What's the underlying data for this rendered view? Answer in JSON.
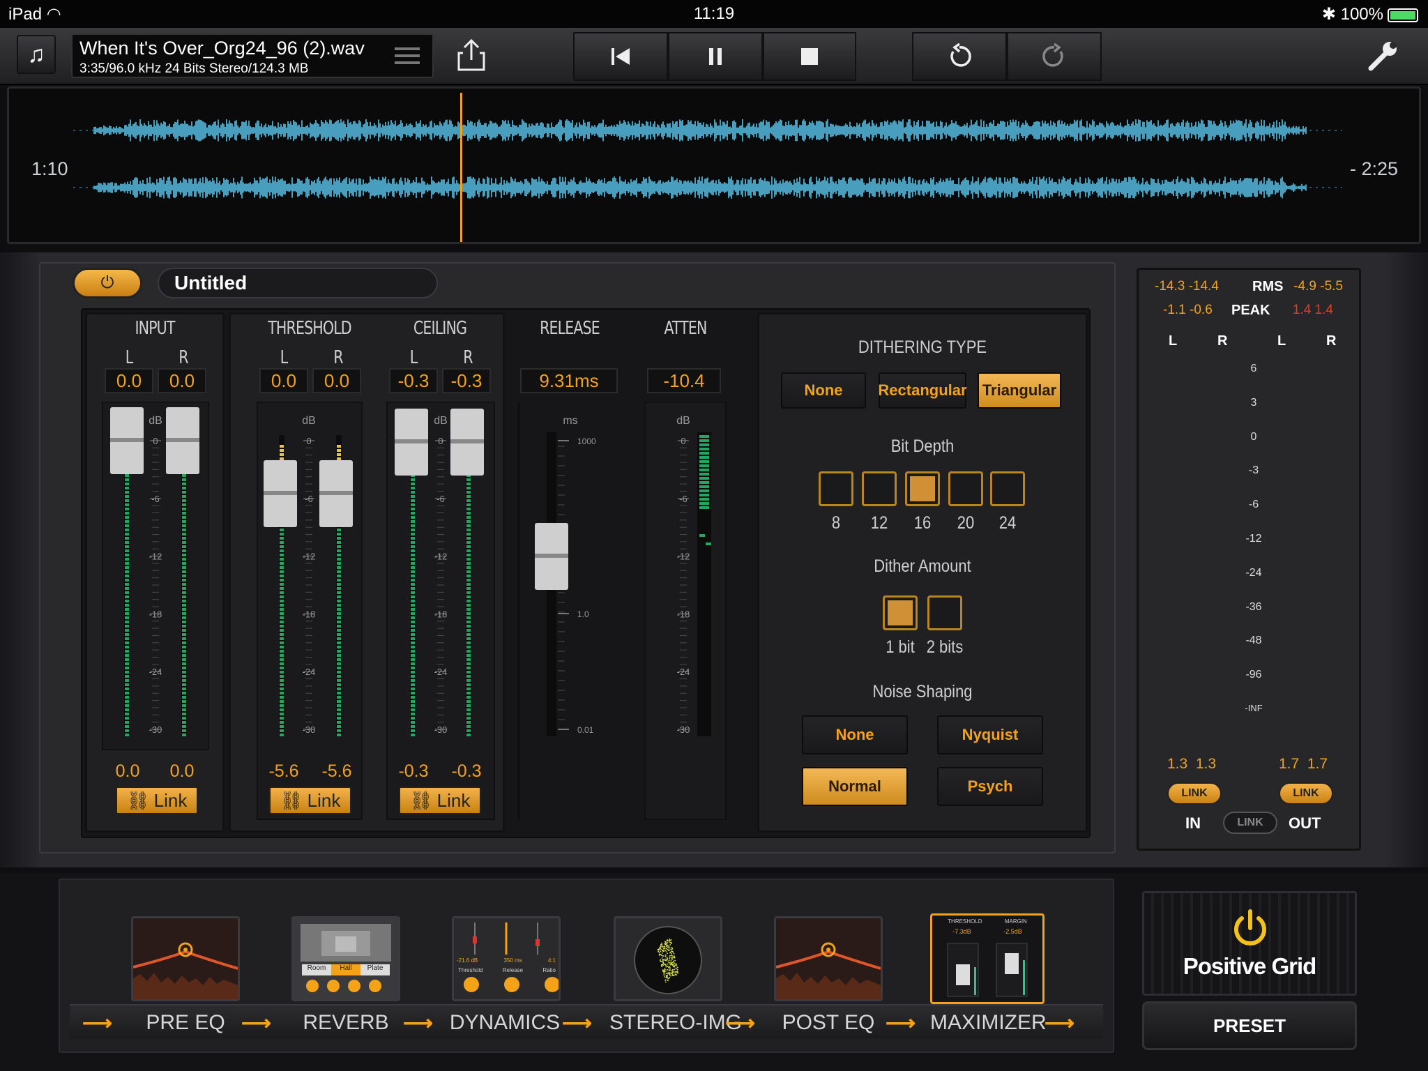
{
  "status_bar": {
    "device": "iPad",
    "time": "11:19",
    "battery": "100%"
  },
  "file": {
    "title": "When It's Over_Org24_96 (2).wav",
    "info": "3:35/96.0 kHz 24 Bits Stereo/124.3 MB"
  },
  "transport": {
    "icons": [
      "skip-back-icon",
      "pause-icon",
      "stop-icon",
      "undo-icon",
      "redo-icon"
    ]
  },
  "waveform": {
    "elapsed": "1:10",
    "remaining": "- 2:25",
    "playhead_fraction": 0.32
  },
  "preset": {
    "name": "Untitled",
    "power_icon": "power-icon"
  },
  "input": {
    "label": "INPUT",
    "l": "L",
    "r": "R",
    "val_l": "0.0",
    "val_r": "0.0",
    "unit": "dB",
    "out_l": "0.0",
    "out_r": "0.0",
    "link": "Link"
  },
  "threshold": {
    "label": "THRESHOLD",
    "l": "L",
    "r": "R",
    "val_l": "0.0",
    "val_r": "0.0",
    "unit": "dB",
    "out_l": "-5.6",
    "out_r": "-5.6",
    "link": "Link"
  },
  "ceiling": {
    "label": "CEILING",
    "l": "L",
    "r": "R",
    "val_l": "-0.3",
    "val_r": "-0.3",
    "unit": "dB",
    "out_l": "-0.3",
    "out_r": "-0.3",
    "link": "Link"
  },
  "release": {
    "label": "RELEASE",
    "value": "9.31ms",
    "unit": "ms",
    "ticks": [
      "1000",
      "1.0",
      "0.01"
    ]
  },
  "atten": {
    "label": "ATTEN",
    "value": "-10.4",
    "unit": "dB"
  },
  "db_ticks": [
    "0",
    "-6",
    "-12",
    "-18",
    "-24",
    "-30"
  ],
  "dithering": {
    "title": "DITHERING TYPE",
    "types": [
      "None",
      "Rectangular",
      "Triangular"
    ],
    "bit_depth_title": "Bit Depth",
    "bit_depths": [
      "8",
      "12",
      "16",
      "20",
      "24"
    ],
    "amount_title": "Dither Amount",
    "amounts": [
      "1 bit",
      "2 bits"
    ],
    "noise_title": "Noise Shaping",
    "noise": [
      "None",
      "Nyquist",
      "Normal",
      "Psych"
    ]
  },
  "meters": {
    "in_rms_l": "-14.3",
    "in_rms_r": "-14.4",
    "rms": "RMS",
    "out_rms_l": "-4.9",
    "out_rms_r": "-5.5",
    "in_peak_l": "-1.1",
    "in_peak_r": "-0.6",
    "peak": "PEAK",
    "out_peak_l": "1.4",
    "out_peak_r": "1.4",
    "l": "L",
    "r": "R",
    "scale": [
      "6",
      "3",
      "0",
      "-3",
      "-6",
      "-12",
      "-24",
      "-36",
      "-48",
      "-96",
      "-INF"
    ],
    "in_gain_l": "1.3",
    "in_gain_r": "1.3",
    "out_gain_l": "1.7",
    "out_gain_r": "1.7",
    "link": "LINK",
    "in": "IN",
    "out": "OUT"
  },
  "chain": {
    "modules": [
      "PRE EQ",
      "REVERB",
      "DYNAMICS",
      "STEREO-IMG",
      "POST EQ",
      "MAXIMIZER"
    ],
    "reverb_modes": [
      "Room",
      "Hall",
      "Plate"
    ],
    "dyn_vals": [
      "-21.6 dB",
      "350 ms",
      "4:1"
    ],
    "dyn_labels": [
      "Threshold",
      "Release",
      "Ratio"
    ],
    "max_labels": [
      "THRESHOLD",
      "MARGIN"
    ],
    "max_vals": [
      "-7.3dB",
      "-2.5dB"
    ]
  },
  "brand": {
    "name": "Positive Grid",
    "preset_button": "PRESET"
  }
}
